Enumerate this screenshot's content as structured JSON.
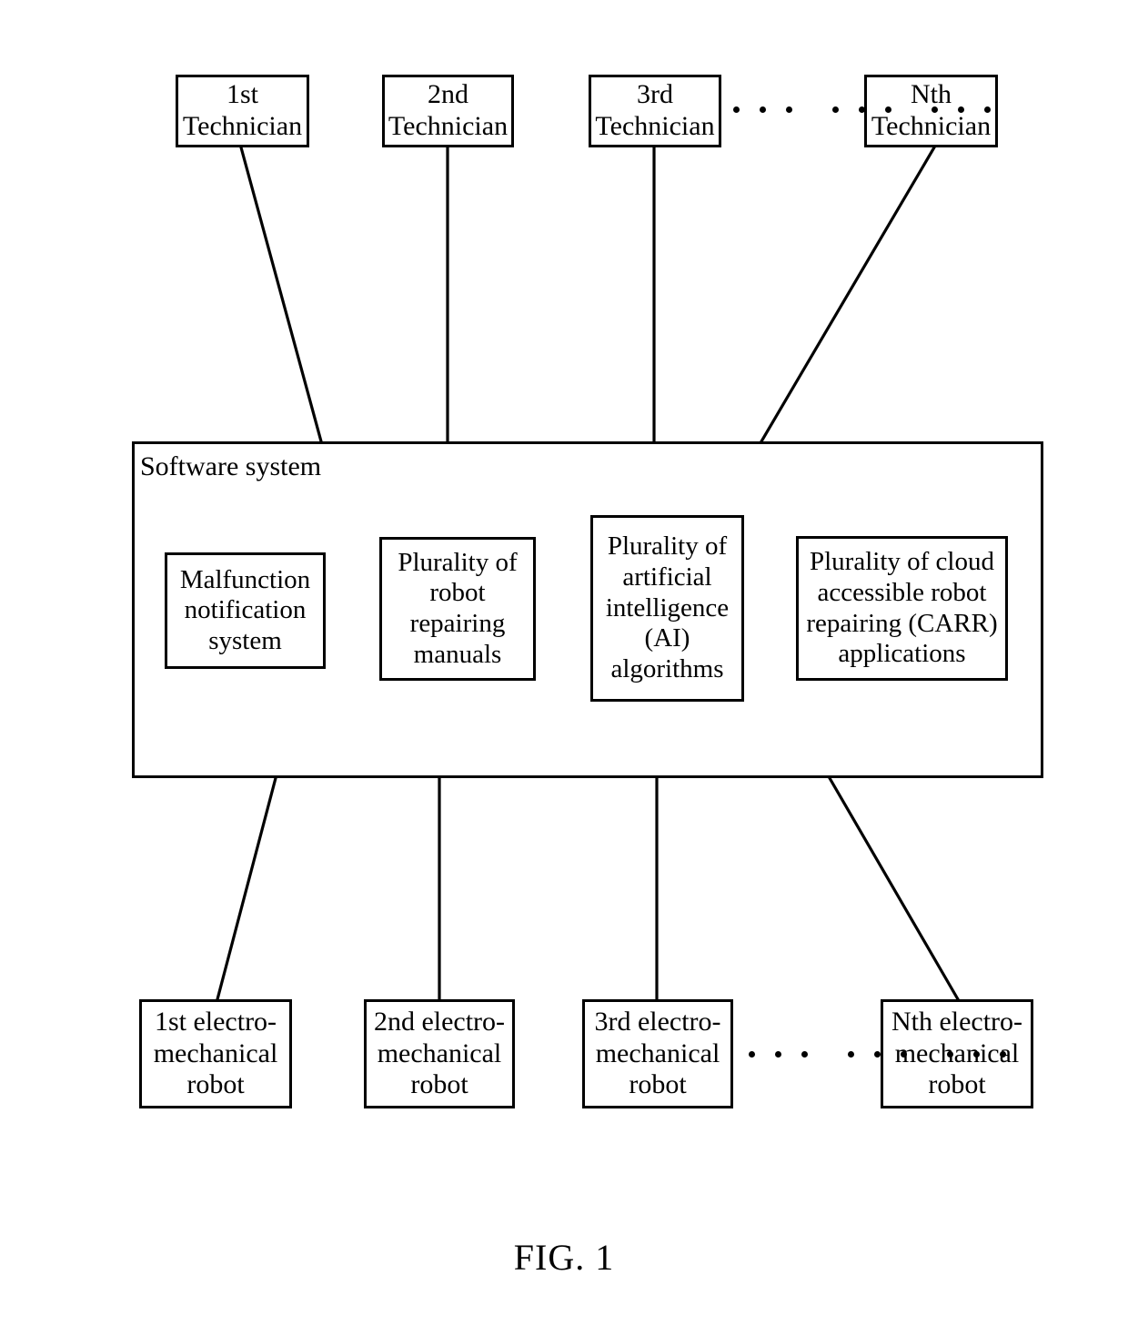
{
  "figure": {
    "caption": "FIG. 1",
    "ink_color": "#000000",
    "background_color": "#ffffff"
  },
  "technicians": {
    "row_label": "Technician row",
    "items": [
      {
        "line1": "1st",
        "line2": "Technician"
      },
      {
        "line1": "2nd",
        "line2": "Technician"
      },
      {
        "line1": "3rd",
        "line2": "Technician"
      },
      {
        "line1": "Nth",
        "line2": "Technician"
      }
    ],
    "ellipsis": "· · ·   · · ·   · · ·"
  },
  "software_system": {
    "label": "Software system",
    "components": [
      {
        "text": "Malfunction notification system"
      },
      {
        "text": "Plurality of robot repairing manuals"
      },
      {
        "text": "Plurality of artificial intelligence (AI) algorithms"
      },
      {
        "text": "Plurality of cloud accessible robot repairing (CARR) applications"
      }
    ]
  },
  "robots": {
    "row_label": "Electro-mechanical robot row",
    "items": [
      {
        "line1": "1st electro-",
        "line2": "mechanical",
        "line3": "robot"
      },
      {
        "line1": "2nd electro-",
        "line2": "mechanical",
        "line3": "robot"
      },
      {
        "line1": "3rd electro-",
        "line2": "mechanical",
        "line3": "robot"
      },
      {
        "line1": "Nth electro-",
        "line2": "mechanical",
        "line3": "robot"
      }
    ],
    "ellipsis": "· · ·   · · ·   · · ·"
  },
  "connections": [
    {
      "from": "1st Technician",
      "to": "Software system"
    },
    {
      "from": "2nd Technician",
      "to": "Software system"
    },
    {
      "from": "3rd Technician",
      "to": "Software system"
    },
    {
      "from": "Nth Technician",
      "to": "Software system"
    },
    {
      "from": "Software system",
      "to": "1st electro-mechanical robot"
    },
    {
      "from": "Software system",
      "to": "2nd electro-mechanical robot"
    },
    {
      "from": "Software system",
      "to": "3rd electro-mechanical robot"
    },
    {
      "from": "Software system",
      "to": "Nth electro-mechanical robot"
    }
  ]
}
